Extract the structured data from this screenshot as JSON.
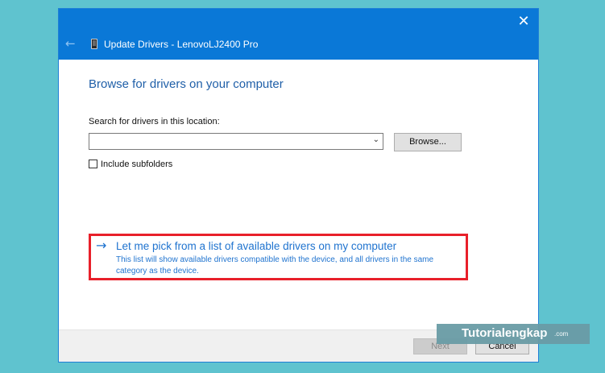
{
  "window": {
    "title": "Update Drivers - LenovoLJ2400 Pro",
    "close_icon": "close-icon",
    "back_icon": "back-arrow-icon",
    "device_icon": "printer-device-icon",
    "colors": {
      "titlebar": "#0a78d7",
      "accent_text": "#1f73cf",
      "highlight_border": "#e8202a"
    }
  },
  "page": {
    "heading": "Browse for drivers on your computer",
    "search_label": "Search for drivers in this location:",
    "search_value": "",
    "browse_label": "Browse...",
    "include_subfolders_label": "Include subfolders",
    "include_subfolders_checked": false
  },
  "pick_option": {
    "arrow": "→",
    "title": "Let me pick from a list of available drivers on my computer",
    "description": "This list will show available drivers compatible with the device, and all drivers in the same category as the device."
  },
  "footer": {
    "next_label": "Next",
    "cancel_label": "Cancel"
  },
  "watermark": {
    "main": "Tutorialengkap",
    "tld": ".com"
  }
}
